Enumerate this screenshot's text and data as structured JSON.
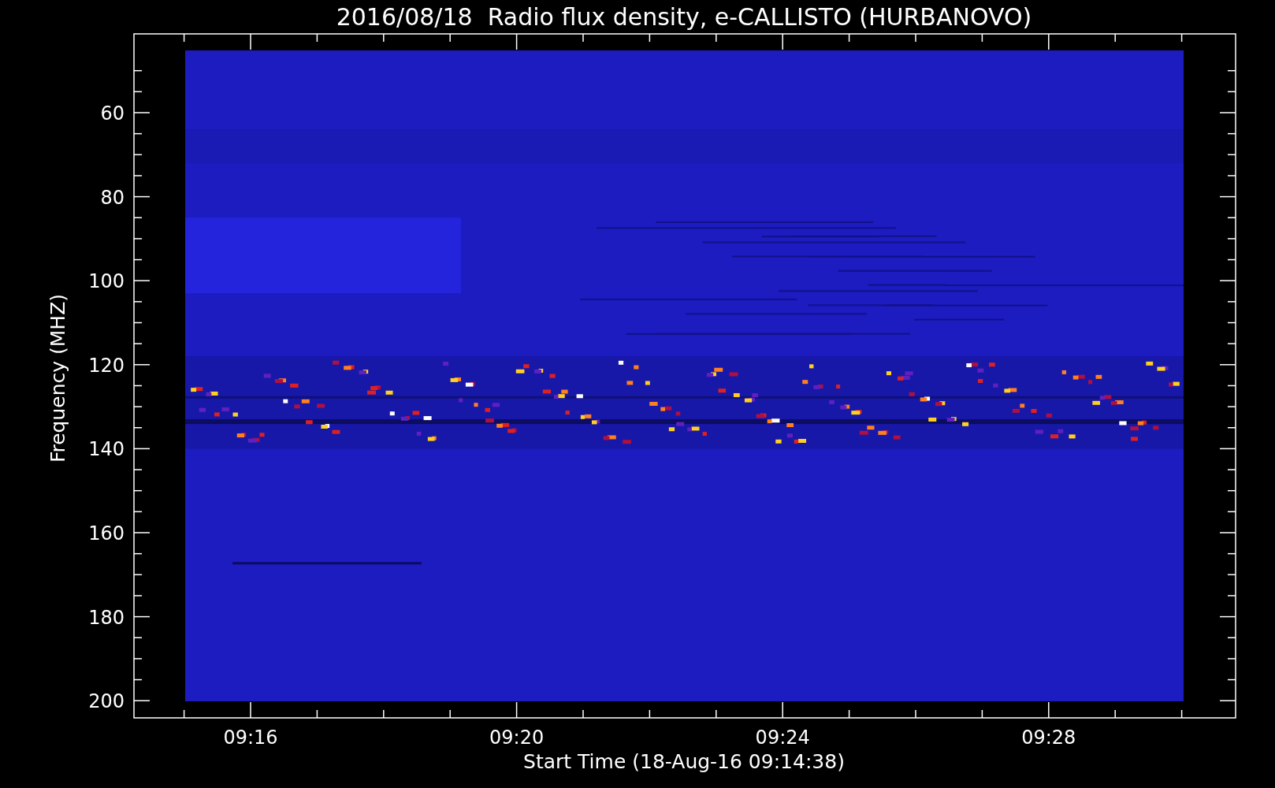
{
  "title": "2016/08/18  Radio flux density, e-CALLISTO (HURBANOVO)",
  "y_axis": {
    "label": "Frequency (MHZ)",
    "ticks": [
      "60",
      "80",
      "100",
      "120",
      "140",
      "160",
      "180",
      "200"
    ]
  },
  "x_axis": {
    "label": "Start Time (18-Aug-16 09:14:38)",
    "ticks": [
      "09:16",
      "09:20",
      "09:24",
      "09:28"
    ]
  }
}
